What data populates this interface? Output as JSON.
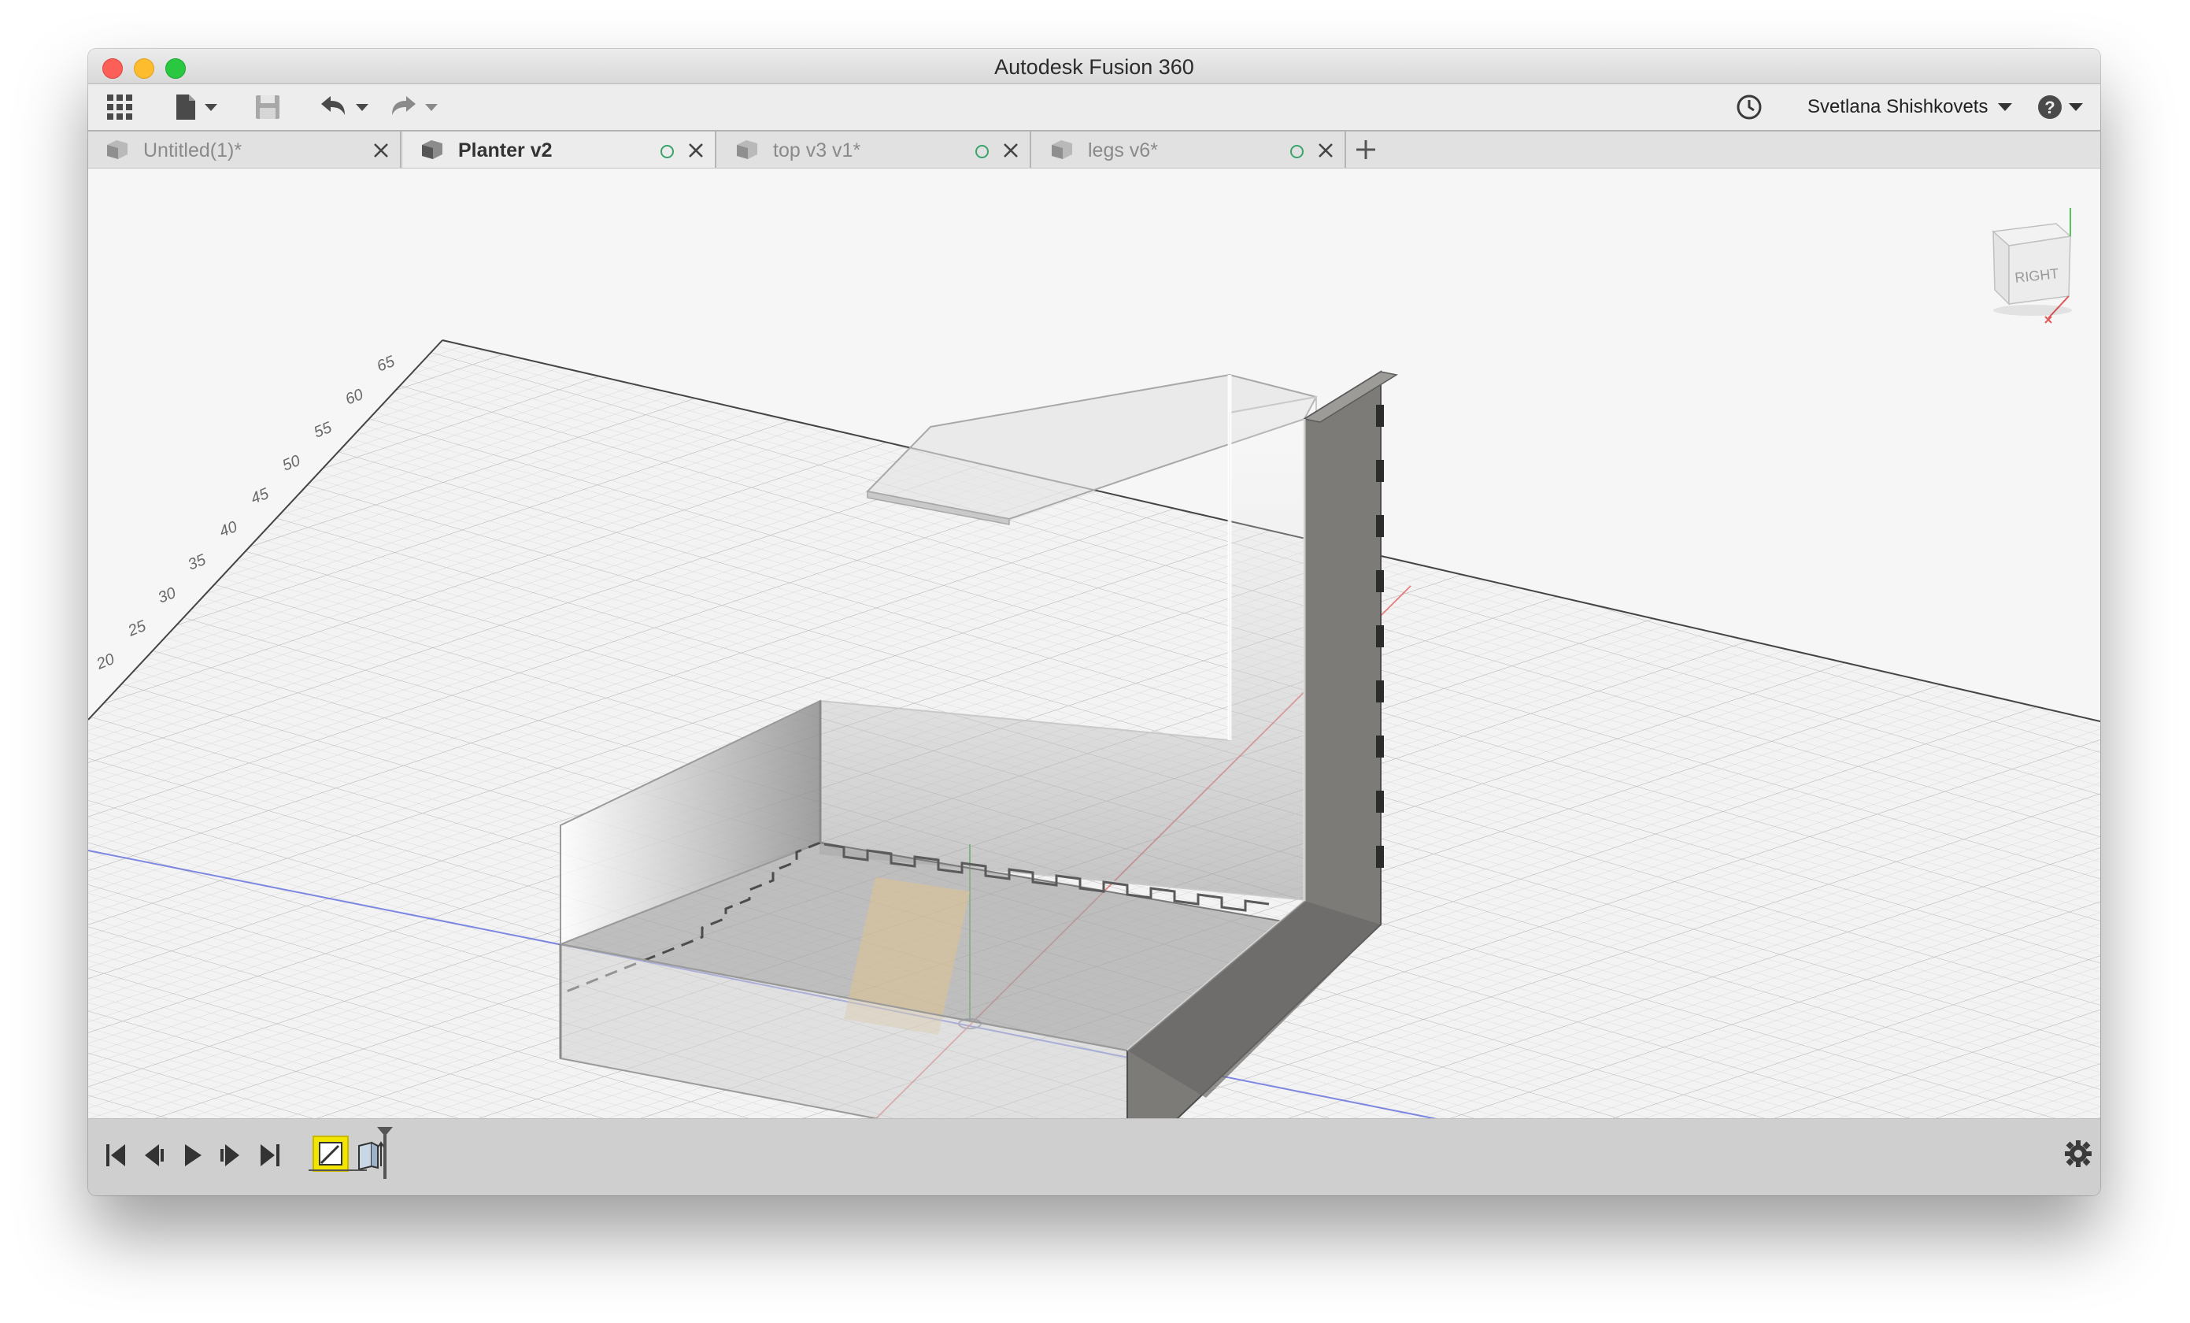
{
  "window": {
    "title": "Autodesk Fusion 360"
  },
  "toolbar": {
    "user": "Svetlana Shishkovets",
    "icons": [
      "grid-apps-icon",
      "file-icon",
      "save-icon",
      "undo-icon",
      "redo-icon",
      "history-clock-icon",
      "help-icon"
    ]
  },
  "tabs": [
    {
      "label": "Untitled(1)*",
      "active": false,
      "saved_indicator": false
    },
    {
      "label": "Planter v2",
      "active": true,
      "saved_indicator": true
    },
    {
      "label": "top v3 v1*",
      "active": false,
      "saved_indicator": true
    },
    {
      "label": "legs v6*",
      "active": false,
      "saved_indicator": true
    }
  ],
  "viewport": {
    "grid_labels": [
      "65",
      "60",
      "55",
      "50",
      "45",
      "40",
      "35",
      "30",
      "25",
      "20"
    ],
    "viewcube": {
      "face": "RIGHT",
      "axes": [
        "X",
        "Y",
        "Z"
      ]
    }
  },
  "timeline": {
    "controls": [
      "first",
      "previous",
      "play",
      "next",
      "last"
    ],
    "features": [
      "sketch-feature",
      "extrude-feature"
    ]
  },
  "colors": {
    "grid": "#c9c9c9",
    "x_axis": "#e05a5a",
    "y_axis": "#5ac25a",
    "z_axis": "#4a5adc",
    "selection": "#f2e600",
    "panel_face": "#7d7b78"
  }
}
